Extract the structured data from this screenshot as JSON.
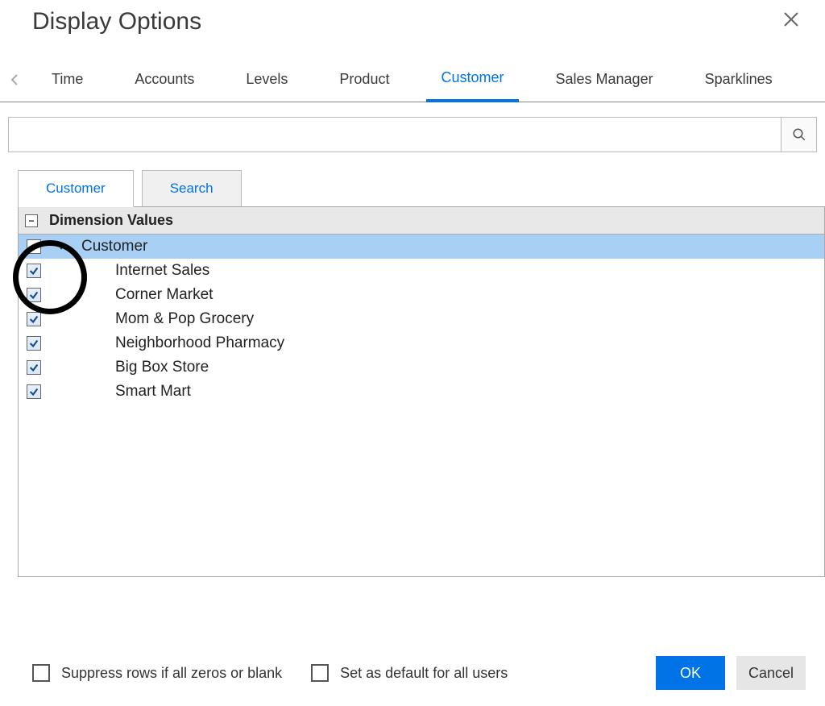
{
  "dialog_title": "Display Options",
  "main_tabs": {
    "items": [
      "Time",
      "Accounts",
      "Levels",
      "Product",
      "Customer",
      "Sales Manager",
      "Sparklines"
    ],
    "active_index": 4
  },
  "search": {
    "value": ""
  },
  "sub_tabs": {
    "items": [
      "Customer",
      "Search"
    ],
    "active_index": 0
  },
  "tree": {
    "header": "Dimension Values",
    "root": {
      "label": "Customer",
      "checked": false,
      "expanded": true,
      "selected": true
    },
    "children": [
      {
        "label": "Internet Sales",
        "checked": true
      },
      {
        "label": "Corner Market",
        "checked": true
      },
      {
        "label": "Mom & Pop Grocery",
        "checked": true
      },
      {
        "label": "Neighborhood Pharmacy",
        "checked": true
      },
      {
        "label": "Big Box Store",
        "checked": true
      },
      {
        "label": "Smart Mart",
        "checked": true
      }
    ]
  },
  "footer": {
    "suppress_label": "Suppress rows if all zeros or blank",
    "suppress_checked": false,
    "default_label": "Set as default for all users",
    "default_checked": false,
    "ok_label": "OK",
    "cancel_label": "Cancel"
  }
}
